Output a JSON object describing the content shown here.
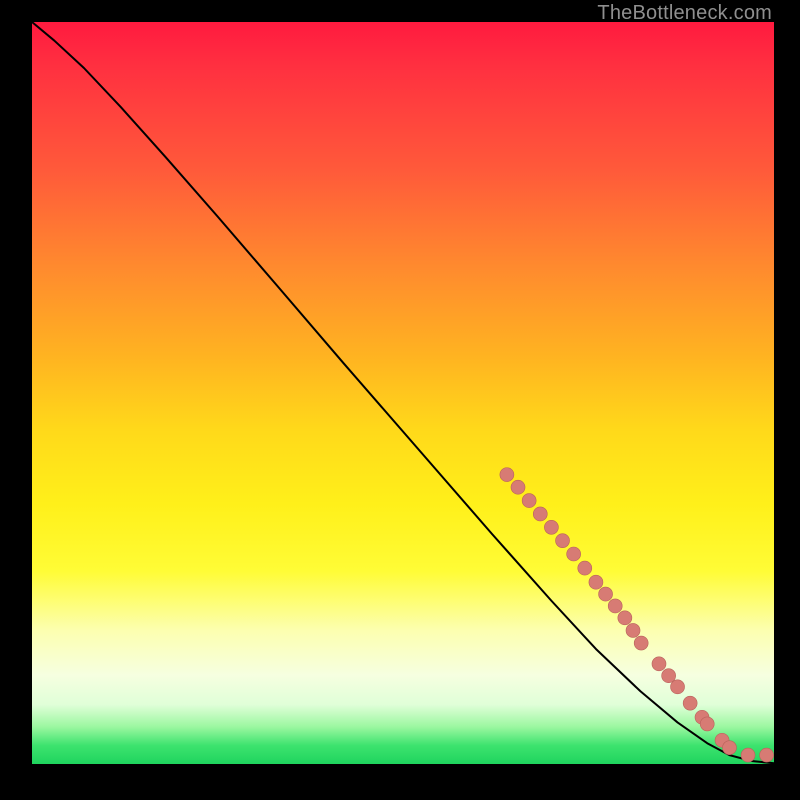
{
  "attribution": "TheBottleneck.com",
  "colors": {
    "dot_fill": "#d77b74",
    "dot_stroke": "#b9625b",
    "curve": "#000000",
    "background_outer": "#000000"
  },
  "chart_data": {
    "type": "line",
    "title": "",
    "xlabel": "",
    "ylabel": "",
    "xlim": [
      0,
      100
    ],
    "ylim": [
      0,
      100
    ],
    "grid": false,
    "legend": false,
    "axis_ticks_visible": false,
    "note": "Bottleneck-style curve. Axes are unlabeled in the source; x/y are normalized 0–100. Curve runs from top-left toward bottom-right, flattening near y≈0 at the right edge. Salmon dots mark a cluster of points along the lower-right portion of the curve.",
    "curve": [
      {
        "x": 0,
        "y": 100
      },
      {
        "x": 3,
        "y": 97.5
      },
      {
        "x": 7,
        "y": 93.8
      },
      {
        "x": 12,
        "y": 88.5
      },
      {
        "x": 18,
        "y": 81.8
      },
      {
        "x": 25,
        "y": 73.8
      },
      {
        "x": 33,
        "y": 64.5
      },
      {
        "x": 42,
        "y": 54.0
      },
      {
        "x": 52,
        "y": 42.5
      },
      {
        "x": 62,
        "y": 31.0
      },
      {
        "x": 70,
        "y": 22.0
      },
      {
        "x": 76,
        "y": 15.5
      },
      {
        "x": 82,
        "y": 9.8
      },
      {
        "x": 87,
        "y": 5.6
      },
      {
        "x": 91,
        "y": 2.8
      },
      {
        "x": 94,
        "y": 1.2
      },
      {
        "x": 97,
        "y": 0.4
      },
      {
        "x": 100,
        "y": 0.1
      }
    ],
    "dots": [
      {
        "x": 64.0,
        "y": 39.0
      },
      {
        "x": 65.5,
        "y": 37.3
      },
      {
        "x": 67.0,
        "y": 35.5
      },
      {
        "x": 68.5,
        "y": 33.7
      },
      {
        "x": 70.0,
        "y": 31.9
      },
      {
        "x": 71.5,
        "y": 30.1
      },
      {
        "x": 73.0,
        "y": 28.3
      },
      {
        "x": 74.5,
        "y": 26.4
      },
      {
        "x": 76.0,
        "y": 24.5
      },
      {
        "x": 77.3,
        "y": 22.9
      },
      {
        "x": 78.6,
        "y": 21.3
      },
      {
        "x": 79.9,
        "y": 19.7
      },
      {
        "x": 81.0,
        "y": 18.0
      },
      {
        "x": 82.1,
        "y": 16.3
      },
      {
        "x": 84.5,
        "y": 13.5
      },
      {
        "x": 85.8,
        "y": 11.9
      },
      {
        "x": 87.0,
        "y": 10.4
      },
      {
        "x": 88.7,
        "y": 8.2
      },
      {
        "x": 90.3,
        "y": 6.3
      },
      {
        "x": 91.0,
        "y": 5.4
      },
      {
        "x": 93.0,
        "y": 3.2
      },
      {
        "x": 94.0,
        "y": 2.2
      },
      {
        "x": 96.5,
        "y": 1.2
      },
      {
        "x": 99.0,
        "y": 1.2
      }
    ],
    "dot_radius_px": 7
  }
}
